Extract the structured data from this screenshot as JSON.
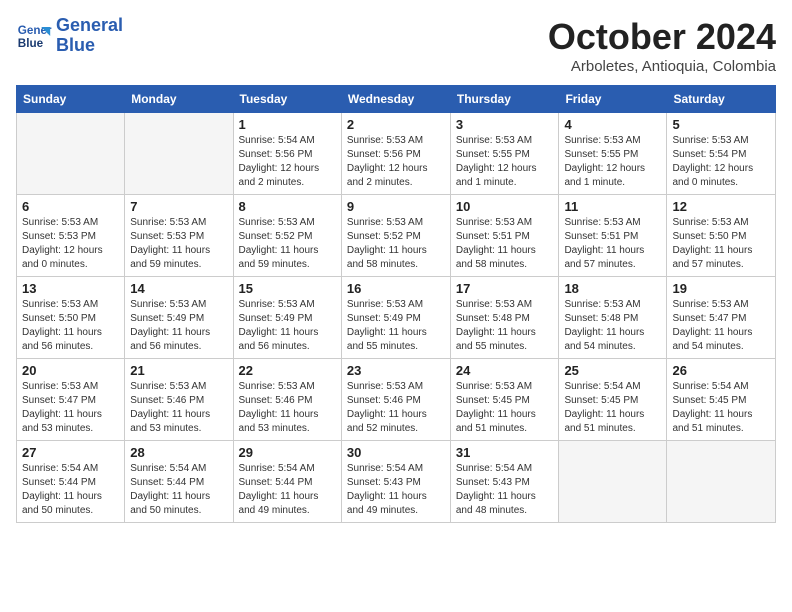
{
  "header": {
    "logo_line1": "General",
    "logo_line2": "Blue",
    "month": "October 2024",
    "location": "Arboletes, Antioquia, Colombia"
  },
  "weekdays": [
    "Sunday",
    "Monday",
    "Tuesday",
    "Wednesday",
    "Thursday",
    "Friday",
    "Saturday"
  ],
  "weeks": [
    [
      {
        "day": "",
        "detail": ""
      },
      {
        "day": "",
        "detail": ""
      },
      {
        "day": "1",
        "detail": "Sunrise: 5:54 AM\nSunset: 5:56 PM\nDaylight: 12 hours\nand 2 minutes."
      },
      {
        "day": "2",
        "detail": "Sunrise: 5:53 AM\nSunset: 5:56 PM\nDaylight: 12 hours\nand 2 minutes."
      },
      {
        "day": "3",
        "detail": "Sunrise: 5:53 AM\nSunset: 5:55 PM\nDaylight: 12 hours\nand 1 minute."
      },
      {
        "day": "4",
        "detail": "Sunrise: 5:53 AM\nSunset: 5:55 PM\nDaylight: 12 hours\nand 1 minute."
      },
      {
        "day": "5",
        "detail": "Sunrise: 5:53 AM\nSunset: 5:54 PM\nDaylight: 12 hours\nand 0 minutes."
      }
    ],
    [
      {
        "day": "6",
        "detail": "Sunrise: 5:53 AM\nSunset: 5:53 PM\nDaylight: 12 hours\nand 0 minutes."
      },
      {
        "day": "7",
        "detail": "Sunrise: 5:53 AM\nSunset: 5:53 PM\nDaylight: 11 hours\nand 59 minutes."
      },
      {
        "day": "8",
        "detail": "Sunrise: 5:53 AM\nSunset: 5:52 PM\nDaylight: 11 hours\nand 59 minutes."
      },
      {
        "day": "9",
        "detail": "Sunrise: 5:53 AM\nSunset: 5:52 PM\nDaylight: 11 hours\nand 58 minutes."
      },
      {
        "day": "10",
        "detail": "Sunrise: 5:53 AM\nSunset: 5:51 PM\nDaylight: 11 hours\nand 58 minutes."
      },
      {
        "day": "11",
        "detail": "Sunrise: 5:53 AM\nSunset: 5:51 PM\nDaylight: 11 hours\nand 57 minutes."
      },
      {
        "day": "12",
        "detail": "Sunrise: 5:53 AM\nSunset: 5:50 PM\nDaylight: 11 hours\nand 57 minutes."
      }
    ],
    [
      {
        "day": "13",
        "detail": "Sunrise: 5:53 AM\nSunset: 5:50 PM\nDaylight: 11 hours\nand 56 minutes."
      },
      {
        "day": "14",
        "detail": "Sunrise: 5:53 AM\nSunset: 5:49 PM\nDaylight: 11 hours\nand 56 minutes."
      },
      {
        "day": "15",
        "detail": "Sunrise: 5:53 AM\nSunset: 5:49 PM\nDaylight: 11 hours\nand 56 minutes."
      },
      {
        "day": "16",
        "detail": "Sunrise: 5:53 AM\nSunset: 5:49 PM\nDaylight: 11 hours\nand 55 minutes."
      },
      {
        "day": "17",
        "detail": "Sunrise: 5:53 AM\nSunset: 5:48 PM\nDaylight: 11 hours\nand 55 minutes."
      },
      {
        "day": "18",
        "detail": "Sunrise: 5:53 AM\nSunset: 5:48 PM\nDaylight: 11 hours\nand 54 minutes."
      },
      {
        "day": "19",
        "detail": "Sunrise: 5:53 AM\nSunset: 5:47 PM\nDaylight: 11 hours\nand 54 minutes."
      }
    ],
    [
      {
        "day": "20",
        "detail": "Sunrise: 5:53 AM\nSunset: 5:47 PM\nDaylight: 11 hours\nand 53 minutes."
      },
      {
        "day": "21",
        "detail": "Sunrise: 5:53 AM\nSunset: 5:46 PM\nDaylight: 11 hours\nand 53 minutes."
      },
      {
        "day": "22",
        "detail": "Sunrise: 5:53 AM\nSunset: 5:46 PM\nDaylight: 11 hours\nand 53 minutes."
      },
      {
        "day": "23",
        "detail": "Sunrise: 5:53 AM\nSunset: 5:46 PM\nDaylight: 11 hours\nand 52 minutes."
      },
      {
        "day": "24",
        "detail": "Sunrise: 5:53 AM\nSunset: 5:45 PM\nDaylight: 11 hours\nand 51 minutes."
      },
      {
        "day": "25",
        "detail": "Sunrise: 5:54 AM\nSunset: 5:45 PM\nDaylight: 11 hours\nand 51 minutes."
      },
      {
        "day": "26",
        "detail": "Sunrise: 5:54 AM\nSunset: 5:45 PM\nDaylight: 11 hours\nand 51 minutes."
      }
    ],
    [
      {
        "day": "27",
        "detail": "Sunrise: 5:54 AM\nSunset: 5:44 PM\nDaylight: 11 hours\nand 50 minutes."
      },
      {
        "day": "28",
        "detail": "Sunrise: 5:54 AM\nSunset: 5:44 PM\nDaylight: 11 hours\nand 50 minutes."
      },
      {
        "day": "29",
        "detail": "Sunrise: 5:54 AM\nSunset: 5:44 PM\nDaylight: 11 hours\nand 49 minutes."
      },
      {
        "day": "30",
        "detail": "Sunrise: 5:54 AM\nSunset: 5:43 PM\nDaylight: 11 hours\nand 49 minutes."
      },
      {
        "day": "31",
        "detail": "Sunrise: 5:54 AM\nSunset: 5:43 PM\nDaylight: 11 hours\nand 48 minutes."
      },
      {
        "day": "",
        "detail": ""
      },
      {
        "day": "",
        "detail": ""
      }
    ]
  ]
}
